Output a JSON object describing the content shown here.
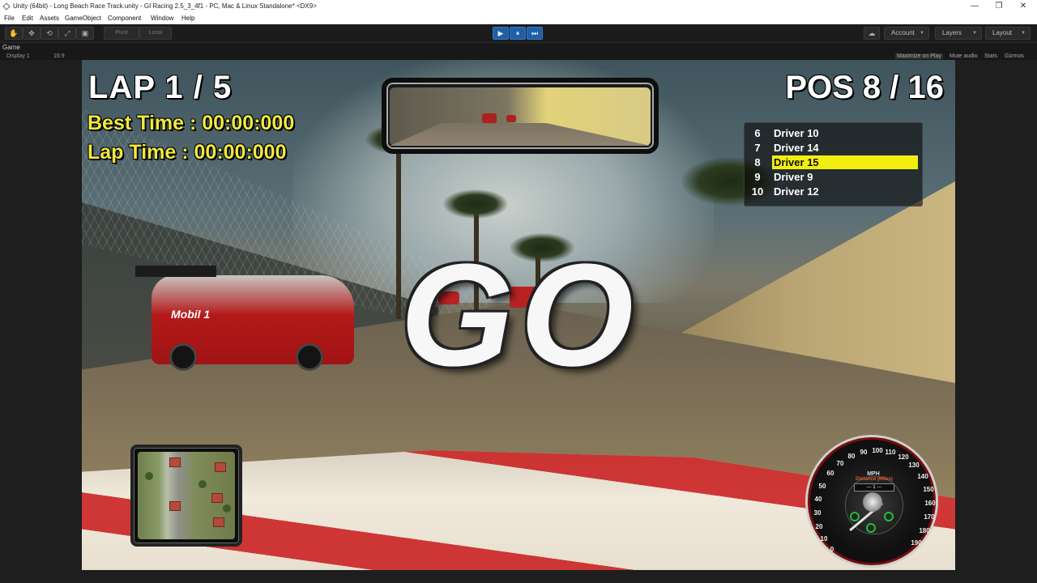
{
  "window": {
    "title": "Unity (64bit) - Long Beach Race Track.unity - GI Racing 2.5_3_4f1 - PC, Mac & Linux Standalone* <DX9>",
    "minimize": "—",
    "maximize": "❐",
    "close": "✕"
  },
  "menu": [
    "File",
    "Edit",
    "Assets",
    "GameObject",
    "Component",
    "Window",
    "Help"
  ],
  "toolbar": {
    "tools": [
      "✋",
      "✥",
      "⟲",
      "⤢",
      "▣"
    ],
    "pivot_label": "Pivot",
    "local_label": "Local",
    "play": "▶",
    "pause": "⏸",
    "step": "⏭",
    "account_label": "Account",
    "layers_label": "Layers",
    "layout_label": "Layout"
  },
  "game_view": {
    "tab_label": "Game",
    "display_label": "Display 1",
    "aspect_label": "16:9",
    "options": [
      "Maximize on Play",
      "Mute audio",
      "Stats",
      "Gizmos"
    ]
  },
  "hud": {
    "lap": "LAP 1 / 5",
    "best_time": "Best Time : 00:00:000",
    "lap_time": "Lap Time : 00:00:000",
    "position": "POS 8 / 16",
    "countdown": "GO",
    "ranking": [
      {
        "num": "6",
        "name": "Driver 10"
      },
      {
        "num": "7",
        "name": "Driver 14"
      },
      {
        "num": "8",
        "name": "Driver 15",
        "highlight": true
      },
      {
        "num": "9",
        "name": "Driver 9"
      },
      {
        "num": "10",
        "name": "Driver 12"
      }
    ],
    "leftcar_brand": "Mobil 1",
    "speedometer": {
      "unit": "MPH",
      "distance_label": "Distance (Miles)",
      "distance_value": "--- 1 ---",
      "ticks": [
        "0",
        "10",
        "20",
        "30",
        "40",
        "50",
        "60",
        "70",
        "80",
        "90",
        "100",
        "110",
        "120",
        "130",
        "140",
        "150",
        "160",
        "170",
        "180",
        "190"
      ]
    }
  },
  "colors": {
    "highlight": "#f2ee10",
    "time_text": "#f0e840",
    "play_button": "#1f5ea8"
  }
}
